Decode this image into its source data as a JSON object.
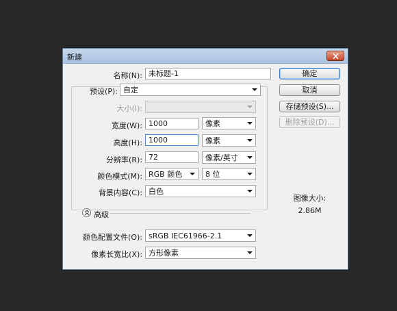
{
  "dialog": {
    "title": "新建"
  },
  "form": {
    "name_label": "名称(N):",
    "name_value": "未标题-1",
    "preset_label": "预设(P):",
    "preset_value": "自定",
    "size_label": "大小(I):",
    "size_value": "",
    "width_label": "宽度(W):",
    "width_value": "1000",
    "width_unit": "像素",
    "height_label": "高度(H):",
    "height_value": "1000",
    "height_unit": "像素",
    "resolution_label": "分辨率(R):",
    "resolution_value": "72",
    "resolution_unit": "像素/英寸",
    "color_mode_label": "颜色模式(M):",
    "color_mode_value": "RGB 颜色",
    "bit_depth_value": "8 位",
    "background_label": "背景内容(C):",
    "background_value": "白色",
    "advanced_label": "高级",
    "color_profile_label": "颜色配置文件(O):",
    "color_profile_value": "sRGB IEC61966-2.1",
    "pixel_aspect_label": "像素长宽比(X):",
    "pixel_aspect_value": "方形像素"
  },
  "buttons": {
    "ok": "确定",
    "cancel": "取消",
    "save_preset": "存储预设(S)...",
    "delete_preset": "删除预设(D)..."
  },
  "image_size": {
    "label": "图像大小:",
    "value": "2.86M"
  }
}
